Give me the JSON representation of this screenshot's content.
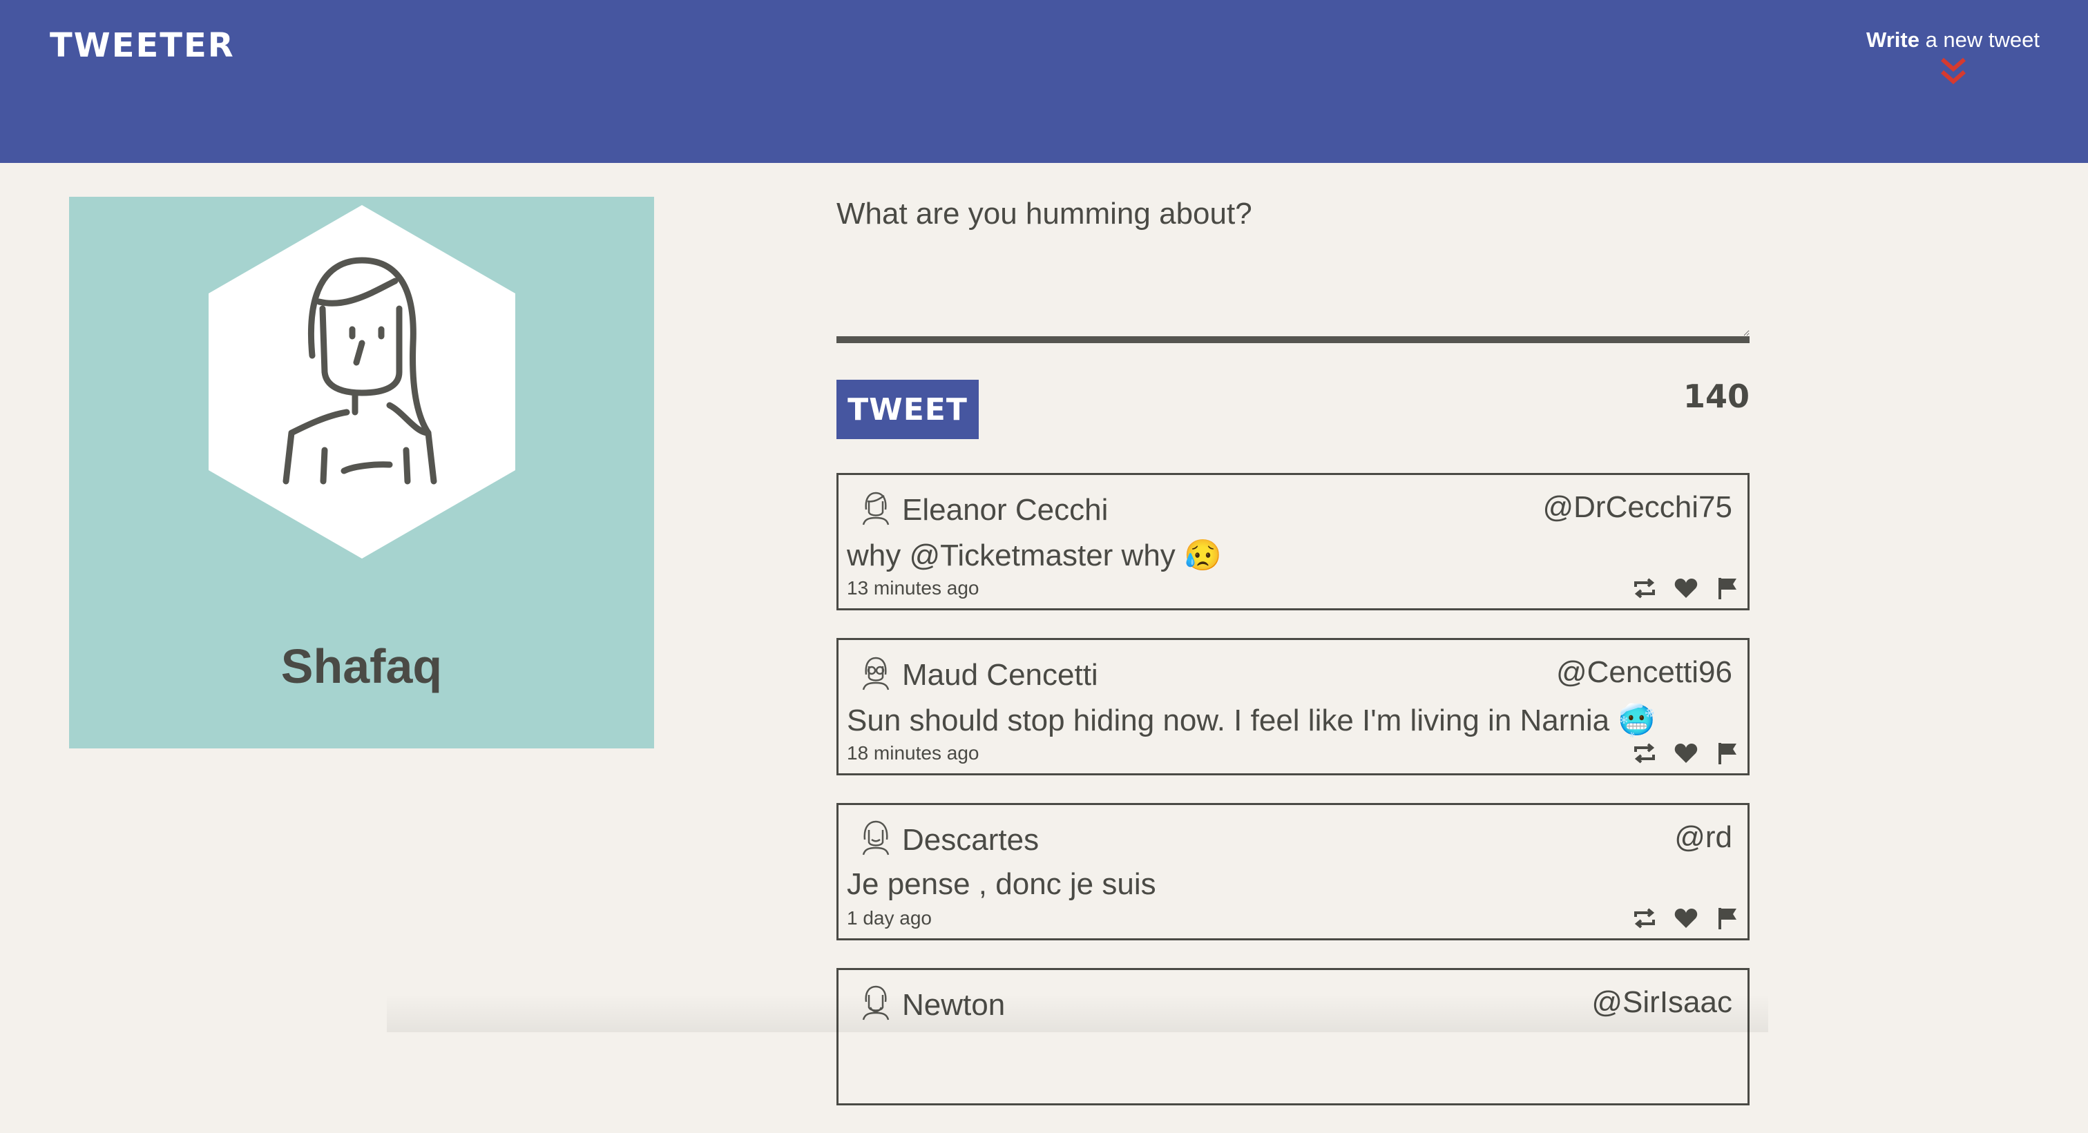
{
  "nav": {
    "brand": "TWEETER",
    "compose_bold": "Write",
    "compose_rest": " a new tweet",
    "chevron_icon": "double-chevron-down-icon",
    "chevron_color": "#d63a2f"
  },
  "colors": {
    "nav_bg": "#4656a0",
    "page_bg": "#f4f1ec",
    "card_bg": "#a6d3cf",
    "text": "#4a4a45"
  },
  "profile": {
    "avatar_icon": "user-avatar-icon",
    "name": "Shafaq"
  },
  "compose": {
    "placeholder": "What are you humming about?",
    "button_label": "TWEET",
    "counter": "140"
  },
  "tweets": [
    {
      "avatar_icon": "user-avatar-icon",
      "author": "Eleanor Cecchi",
      "handle": "@DrCecchi75",
      "text": "why @Ticketmaster why 😥",
      "time": "13 minutes ago"
    },
    {
      "avatar_icon": "user-avatar-icon",
      "author": "Maud Cencetti",
      "handle": "@Cencetti96",
      "text": "Sun should stop hiding now. I feel like I'm living in Narnia 🥶",
      "time": "18 minutes ago"
    },
    {
      "avatar_icon": "user-avatar-icon",
      "author": "Descartes",
      "handle": "@rd",
      "text": "Je pense , donc je suis",
      "time": "1 day ago"
    },
    {
      "avatar_icon": "user-avatar-icon",
      "author": "Newton",
      "handle": "@SirIsaac",
      "text": "",
      "time": ""
    }
  ],
  "tweet_action_icons": [
    "retweet-icon",
    "heart-icon",
    "flag-icon"
  ]
}
